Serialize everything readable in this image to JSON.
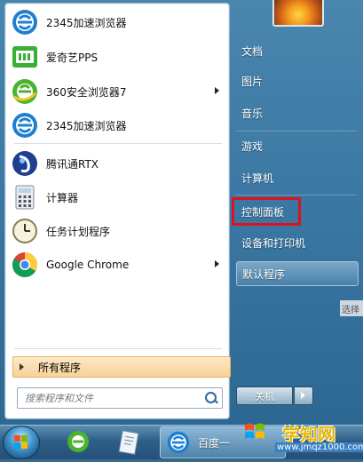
{
  "programs": [
    {
      "label": "2345加速浏览器",
      "icon": "browser-2345-icon",
      "has_arrow": false
    },
    {
      "label": "爱奇艺PPS",
      "icon": "iqiyi-icon",
      "has_arrow": false
    },
    {
      "label": "360安全浏览器7",
      "icon": "browser-360-icon",
      "has_arrow": true
    },
    {
      "label": "2345加速浏览器",
      "icon": "browser-2345-icon",
      "has_arrow": false
    },
    {
      "label": "腾讯通RTX",
      "icon": "rtx-icon",
      "has_arrow": false
    },
    {
      "label": "计算器",
      "icon": "calculator-icon",
      "has_arrow": false
    },
    {
      "label": "任务计划程序",
      "icon": "clock-icon",
      "has_arrow": false
    },
    {
      "label": "Google Chrome",
      "icon": "chrome-icon",
      "has_arrow": true
    }
  ],
  "all_programs": "所有程序",
  "search_placeholder": "搜索程序和文件",
  "right_links": [
    {
      "label": "文档"
    },
    {
      "label": "图片"
    },
    {
      "label": "音乐"
    },
    {
      "label": "游戏"
    },
    {
      "label": "计算机"
    },
    {
      "label": "控制面板"
    },
    {
      "label": "设备和打印机"
    },
    {
      "label": "默认程序"
    }
  ],
  "shutdown_label": "关机",
  "side_tip": "选择",
  "taskbar": {
    "active_label": "百度一"
  },
  "watermark": {
    "main": "学知网",
    "sub": "www.jmqz1000.com"
  },
  "colors": {
    "highlight": "#e01020",
    "panel_blue": "#3b78a3"
  }
}
